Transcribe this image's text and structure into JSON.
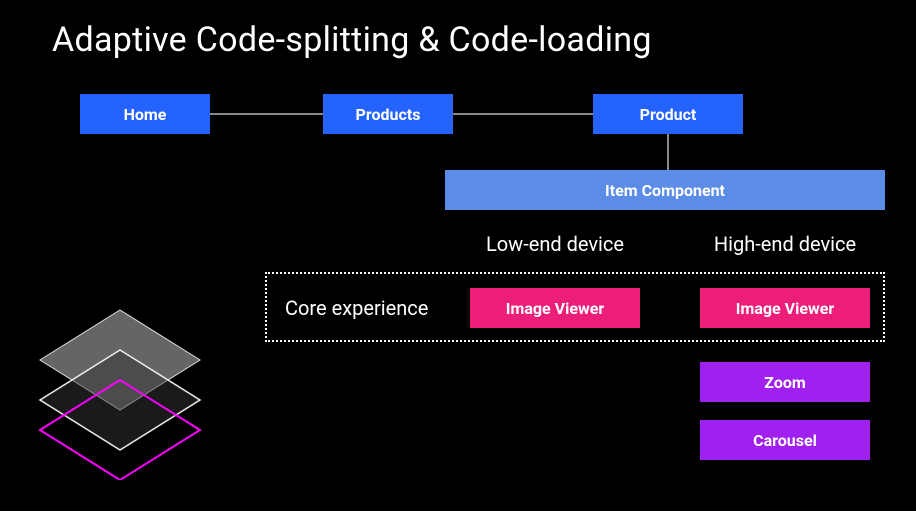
{
  "title": "Adaptive Code-splitting & Code-loading",
  "nav": {
    "home": "Home",
    "products": "Products",
    "product": "Product"
  },
  "item_component": "Item Component",
  "columns": {
    "low": "Low-end device",
    "high": "High-end device"
  },
  "core_label": "Core experience",
  "modules": {
    "image_viewer": "Image Viewer",
    "zoom": "Zoom",
    "carousel": "Carousel"
  },
  "colors": {
    "blue": "#2563ff",
    "lightblue": "#5b8ce6",
    "pink": "#ec1e79",
    "purple": "#a020f0"
  }
}
